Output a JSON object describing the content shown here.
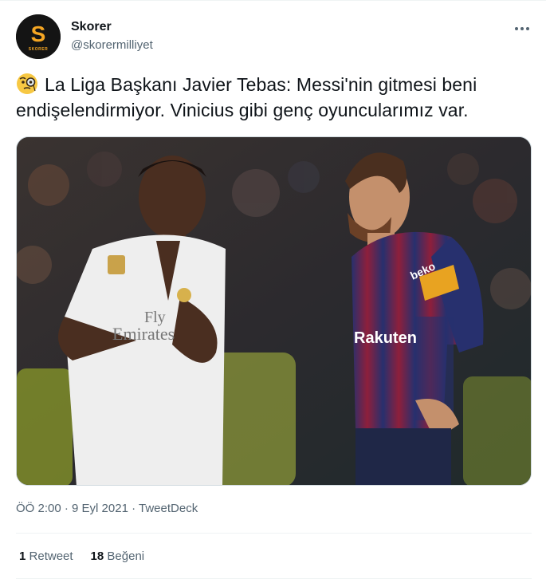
{
  "author": {
    "display_name": "Skorer",
    "handle": "@skorermilliyet",
    "avatar_letter": "S",
    "avatar_caption": "SKORER",
    "avatar_color": "#f5a623"
  },
  "menu": {
    "more_icon": "more-horizontal-icon"
  },
  "tweet": {
    "emoji": "monocle-face",
    "text": "La Liga Başkanı Javier Tebas: Messi'nin gitmesi beni endişelendirmiyor. Vinicius gibi genç oyuncularımız var."
  },
  "media": {
    "description": "photo",
    "left_shirt_text_1": "Fly",
    "left_shirt_text_2": "Emirates",
    "right_shirt_sponsor": "Rakuten",
    "right_sleeve_text": "beko"
  },
  "timestamp": {
    "time": "ÖÖ 2:00",
    "separator": " · ",
    "date": "9 Eyl 2021",
    "source": "TweetDeck"
  },
  "stats": {
    "retweets_count": "1",
    "retweets_label": "Retweet",
    "likes_count": "18",
    "likes_label": "Beğeni"
  },
  "colors": {
    "text_primary": "#0f1419",
    "text_secondary": "#536471",
    "divider": "#eff3f4"
  }
}
